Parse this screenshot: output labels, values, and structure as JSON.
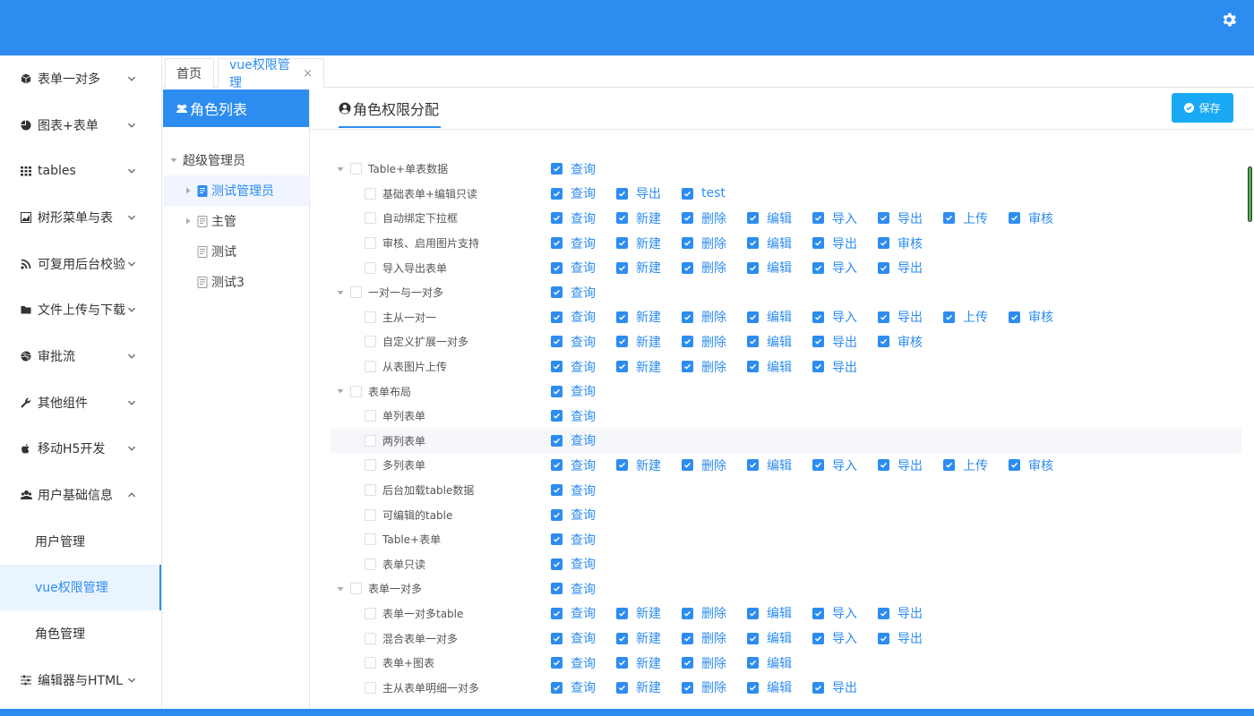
{
  "colors": {
    "primary": "#2d8cf0",
    "save": "#19a9f5"
  },
  "topbar": {
    "settings_icon": "gear-icon"
  },
  "sidebar": {
    "items": [
      {
        "label": "表单一对多",
        "icon": "cube-icon",
        "expanded": false
      },
      {
        "label": "图表+表单",
        "icon": "pie-chart-icon",
        "expanded": false
      },
      {
        "label": "tables",
        "icon": "grid-icon",
        "expanded": false
      },
      {
        "label": "树形菜单与表",
        "icon": "area-chart-icon",
        "expanded": false
      },
      {
        "label": "可复用后台校验",
        "icon": "rss-icon",
        "expanded": false
      },
      {
        "label": "文件上传与下载",
        "icon": "folder-icon",
        "expanded": false
      },
      {
        "label": "审批流",
        "icon": "dribbble-icon",
        "expanded": false
      },
      {
        "label": "其他组件",
        "icon": "wrench-icon",
        "expanded": false
      },
      {
        "label": "移动H5开发",
        "icon": "apple-icon",
        "expanded": false
      },
      {
        "label": "用户基础信息",
        "icon": "users-icon",
        "expanded": true
      },
      {
        "label": "用户管理",
        "sub": true
      },
      {
        "label": "vue权限管理",
        "sub": true,
        "active": true
      },
      {
        "label": "角色管理",
        "sub": true
      },
      {
        "label": "编辑器与HTML",
        "icon": "sliders-icon",
        "expanded": false
      }
    ]
  },
  "tabs": [
    {
      "label": "首页"
    },
    {
      "label": "vue权限管理",
      "close": "×",
      "active": true
    }
  ],
  "role_panel": {
    "title": "角色列表",
    "tree": [
      {
        "label": "超级管理员",
        "level": 0,
        "toggle": "expanded"
      },
      {
        "label": "测试管理员",
        "level": 1,
        "toggle": "collapsed",
        "selected": true
      },
      {
        "label": "主管",
        "level": 1,
        "toggle": "collapsed"
      },
      {
        "label": "测试",
        "level": 1,
        "toggle": "none"
      },
      {
        "label": "测试3",
        "level": 1,
        "toggle": "none"
      }
    ]
  },
  "perm_panel": {
    "title": "角色权限分配",
    "save_label": "保存",
    "rows": [
      {
        "label": "Table+单表数据",
        "level": 0,
        "actions": [
          "查询"
        ]
      },
      {
        "label": "基础表单+编辑只读",
        "level": 1,
        "actions": [
          "查询",
          "导出",
          "test"
        ]
      },
      {
        "label": "自动绑定下拉框",
        "level": 1,
        "actions": [
          "查询",
          "新建",
          "删除",
          "编辑",
          "导入",
          "导出",
          "上传",
          "审核"
        ]
      },
      {
        "label": "审核、启用图片支持",
        "level": 1,
        "actions": [
          "查询",
          "新建",
          "删除",
          "编辑",
          "导出",
          "审核"
        ]
      },
      {
        "label": "导入导出表单",
        "level": 1,
        "actions": [
          "查询",
          "新建",
          "删除",
          "编辑",
          "导入",
          "导出"
        ]
      },
      {
        "label": "一对一与一对多",
        "level": 0,
        "actions": [
          "查询"
        ]
      },
      {
        "label": "主从一对一",
        "level": 1,
        "actions": [
          "查询",
          "新建",
          "删除",
          "编辑",
          "导入",
          "导出",
          "上传",
          "审核"
        ]
      },
      {
        "label": "自定义扩展一对多",
        "level": 1,
        "actions": [
          "查询",
          "新建",
          "删除",
          "编辑",
          "导出",
          "审核"
        ]
      },
      {
        "label": "从表图片上传",
        "level": 1,
        "actions": [
          "查询",
          "新建",
          "删除",
          "编辑",
          "导出"
        ]
      },
      {
        "label": "表单布局",
        "level": 0,
        "actions": [
          "查询"
        ]
      },
      {
        "label": "单列表单",
        "level": 1,
        "actions": [
          "查询"
        ]
      },
      {
        "label": "两列表单",
        "level": 1,
        "actions": [
          "查询"
        ],
        "highlight": true
      },
      {
        "label": "多列表单",
        "level": 1,
        "actions": [
          "查询",
          "新建",
          "删除",
          "编辑",
          "导入",
          "导出",
          "上传",
          "审核"
        ]
      },
      {
        "label": "后台加载table数据",
        "level": 1,
        "actions": [
          "查询"
        ]
      },
      {
        "label": "可编辑的table",
        "level": 1,
        "actions": [
          "查询"
        ]
      },
      {
        "label": "Table+表单",
        "level": 1,
        "actions": [
          "查询"
        ]
      },
      {
        "label": "表单只读",
        "level": 1,
        "actions": [
          "查询"
        ]
      },
      {
        "label": "表单一对多",
        "level": 0,
        "actions": [
          "查询"
        ]
      },
      {
        "label": "表单一对多table",
        "level": 1,
        "actions": [
          "查询",
          "新建",
          "删除",
          "编辑",
          "导入",
          "导出"
        ]
      },
      {
        "label": "混合表单一对多",
        "level": 1,
        "actions": [
          "查询",
          "新建",
          "删除",
          "编辑",
          "导入",
          "导出"
        ]
      },
      {
        "label": "表单+图表",
        "level": 1,
        "actions": [
          "查询",
          "新建",
          "删除",
          "编辑"
        ]
      },
      {
        "label": "主从表单明细一对多",
        "level": 1,
        "actions": [
          "查询",
          "新建",
          "删除",
          "编辑",
          "导出"
        ]
      }
    ]
  }
}
